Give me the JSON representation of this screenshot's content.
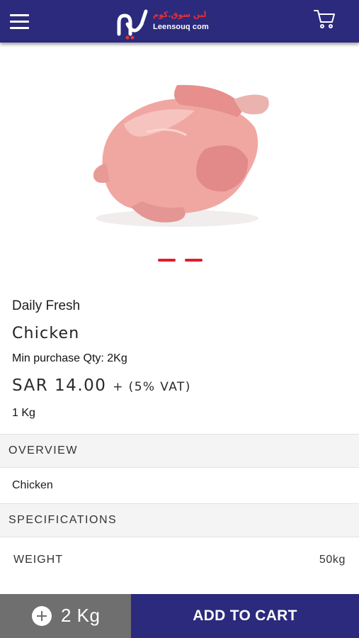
{
  "header": {
    "menu_icon": "hamburger-menu-icon",
    "logo_arabic": "لين سوق.كوم",
    "logo_text": "Leensouq com",
    "cart_icon": "shopping-cart-icon",
    "background_color": "#2b2a7c"
  },
  "gallery": {
    "image_subject": "raw whole chicken",
    "slides": 2,
    "indicator_color": "#e21b2b"
  },
  "product": {
    "brand": "Daily Fresh",
    "name": "Chicken",
    "min_purchase": "Min purchase Qty: 2Kg",
    "price": "SAR 14.00",
    "vat": "+ (5% VAT)",
    "unit": "1 Kg"
  },
  "overview": {
    "title": "OVERVIEW",
    "text": "Chicken"
  },
  "specifications": {
    "title": "SPECIFICATIONS",
    "rows": [
      {
        "label": "WEIGHT",
        "value": "50kg"
      }
    ]
  },
  "bottom_bar": {
    "plus_icon": "plus-circle-icon",
    "quantity": "2 Kg",
    "add_to_cart": "ADD TO CART",
    "quantity_bg": "#6f6f6f",
    "button_bg": "#2b2a7c"
  }
}
